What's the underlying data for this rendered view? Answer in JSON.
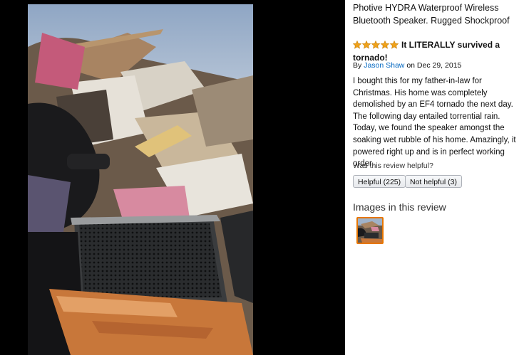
{
  "product": {
    "title": "Photive HYDRA Waterproof Wireless Bluetooth Speaker. Rugged Shockproof"
  },
  "review": {
    "rating": 5,
    "star_color": "#f0a21a",
    "headline": "It LITERALLY survived a tornado!",
    "by_prefix": "By",
    "author": "Jason Shaw",
    "date_text": "on Dec 29, 2015",
    "body": "I bought this for my father-in-law for Christmas. His home was completely demolished by an EF4 tornado the next day. The following day entailed torrential rain. Today, we found the speaker amongst the soaking wet rubble of his home. Amazingly, it powered right up and is in perfect working order."
  },
  "helpful": {
    "question": "Was this review helpful?",
    "yes_label": "Helpful (225)",
    "no_label": "Not helpful (3)"
  },
  "images": {
    "heading": "Images in this review",
    "thumbnail_icon": "review-photo-thumbnail"
  },
  "colors": {
    "link": "#0066c0",
    "thumb_border": "#e77600",
    "background": "#000000"
  }
}
